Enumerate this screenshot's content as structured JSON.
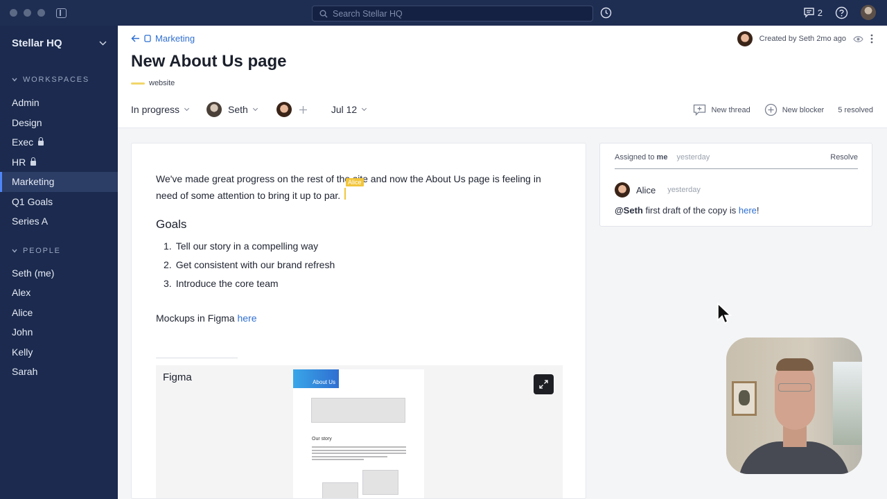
{
  "titlebar": {
    "search_placeholder": "Search Stellar HQ",
    "comment_count": "2"
  },
  "sidebar": {
    "workspace_name": "Stellar HQ",
    "workspaces_label": "WORKSPACES",
    "workspaces": [
      {
        "label": "Admin",
        "locked": false
      },
      {
        "label": "Design",
        "locked": false
      },
      {
        "label": "Exec",
        "locked": true
      },
      {
        "label": "HR",
        "locked": true
      },
      {
        "label": "Marketing",
        "locked": false,
        "active": true
      },
      {
        "label": "Q1 Goals",
        "locked": false
      },
      {
        "label": "Series A",
        "locked": false
      }
    ],
    "people_label": "PEOPLE",
    "people": [
      "Seth (me)",
      "Alex",
      "Alice",
      "John",
      "Kelly",
      "Sarah"
    ]
  },
  "header": {
    "breadcrumb": "Marketing",
    "title": "New About Us page",
    "tag": "website",
    "created_by": "Created by Seth 2mo ago",
    "status": "In progress",
    "assignee": "Seth",
    "due_date": "Jul 12",
    "actions": {
      "new_thread": "New thread",
      "new_blocker": "New blocker",
      "resolved": "5 resolved"
    }
  },
  "doc": {
    "intro": "We've made great progress on the rest of the site and now the About Us page is feeling in need of some attention to bring it up to par.",
    "cursor_user": "Alice",
    "goals_heading": "Goals",
    "goals": [
      {
        "num": "1.",
        "text": "Tell our story in a compelling way"
      },
      {
        "num": "2.",
        "text": "Get consistent with our brand refresh"
      },
      {
        "num": "3.",
        "text": "Introduce the core team"
      }
    ],
    "mockups_text": "Mockups in Figma",
    "mockups_link": "here",
    "figma_label": "Figma",
    "frame_banner": "About Us",
    "frame_heading": "Our story"
  },
  "comment": {
    "assigned_prefix": "Assigned to",
    "assigned_to": "me",
    "assigned_time": "yesterday",
    "resolve_label": "Resolve",
    "author": "Alice",
    "author_time": "yesterday",
    "mention": "@Seth",
    "body": "first draft of the copy is",
    "link": "here",
    "suffix": "!"
  },
  "colors": {
    "titlebar": "#1e2d52",
    "sidebar": "#1b2a4e",
    "accent": "#2f6fd1",
    "cursor": "#f2c63b"
  }
}
